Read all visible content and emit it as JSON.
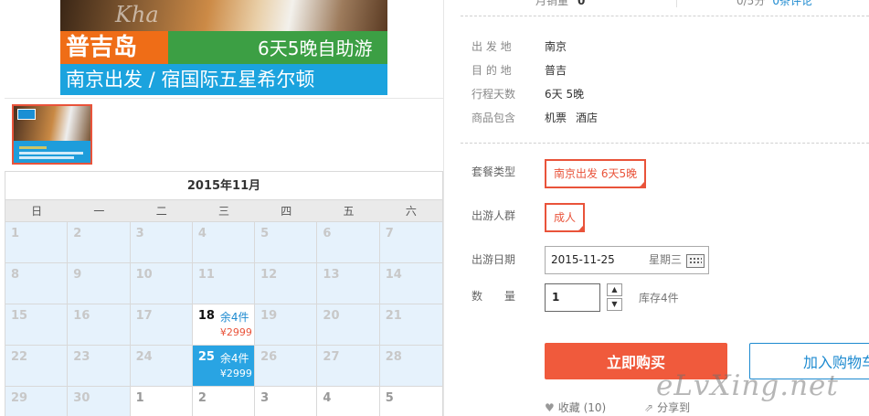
{
  "hero": {
    "title": "普吉岛",
    "subtitle": "6天5晚自助游",
    "line2": "南京出发 / 宿国际五星希尔顿"
  },
  "calendar": {
    "title": "2015年11月",
    "weekdays": [
      "日",
      "一",
      "二",
      "三",
      "四",
      "五",
      "六"
    ],
    "cells": [
      {
        "day": "1"
      },
      {
        "day": "2"
      },
      {
        "day": "3"
      },
      {
        "day": "4"
      },
      {
        "day": "5"
      },
      {
        "day": "6"
      },
      {
        "day": "7"
      },
      {
        "day": "8"
      },
      {
        "day": "9"
      },
      {
        "day": "10"
      },
      {
        "day": "11"
      },
      {
        "day": "12"
      },
      {
        "day": "13"
      },
      {
        "day": "14"
      },
      {
        "day": "15"
      },
      {
        "day": "16"
      },
      {
        "day": "17"
      },
      {
        "day": "18",
        "stock": "余4件",
        "price": "¥2999"
      },
      {
        "day": "19"
      },
      {
        "day": "20"
      },
      {
        "day": "21"
      },
      {
        "day": "22"
      },
      {
        "day": "23"
      },
      {
        "day": "24"
      },
      {
        "day": "25",
        "stock": "余4件",
        "price": "¥2999"
      },
      {
        "day": "26"
      },
      {
        "day": "27"
      },
      {
        "day": "28"
      },
      {
        "day": "29"
      },
      {
        "day": "30"
      },
      {
        "day": "1"
      },
      {
        "day": "2"
      },
      {
        "day": "3"
      },
      {
        "day": "4"
      },
      {
        "day": "5"
      }
    ]
  },
  "stats": {
    "sales_label": "月销量",
    "sales_value": "0",
    "rating": "0/5分",
    "reviews_link": "0条评论"
  },
  "info": [
    {
      "label": "出 发 地",
      "value": "南京"
    },
    {
      "label": "目 的 地",
      "value": "普吉"
    },
    {
      "label": "行程天数",
      "value": "6天 5晚"
    },
    {
      "label": "商品包含",
      "values": [
        "机票",
        "酒店"
      ]
    }
  ],
  "options": {
    "package_label": "套餐类型",
    "package_value": "南京出发 6天5晚",
    "crowd_label": "出游人群",
    "crowd_value": "成人",
    "date_label": "出游日期",
    "date_value": "2015-11-25",
    "date_weekday": "星期三",
    "qty_label": "数　　量",
    "qty_value": "1",
    "stock_text": "库存4件"
  },
  "actions": {
    "buy": "立即购买",
    "cart": "加入购物车",
    "fav": "收藏 (10)",
    "share": "分享到"
  },
  "watermark": "eLvXing.net"
}
